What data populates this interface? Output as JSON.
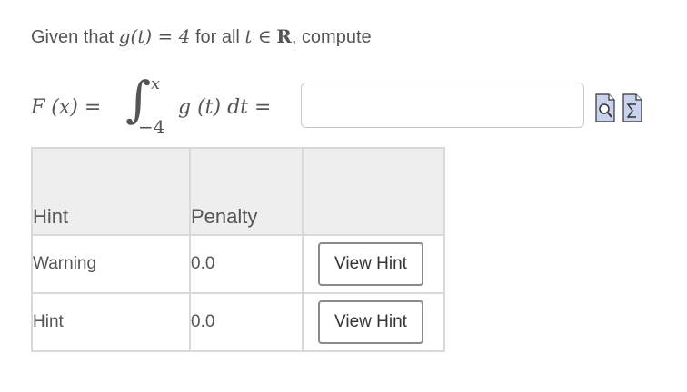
{
  "prompt": {
    "given": "Given that",
    "g_of_t": "g(t) = 4",
    "for_all": "for all",
    "t_in": "t ∈",
    "reals": "R",
    "compute": ", compute"
  },
  "equation": {
    "lhs": "F (x) =",
    "upper_limit": "x",
    "lower_limit": "−4",
    "integrand": "g (t)  dt   ="
  },
  "answer": {
    "value": "",
    "placeholder": ""
  },
  "icons": [
    "preview-icon",
    "equation-editor-icon"
  ],
  "hints_table": {
    "headers": [
      "Hint",
      "Penalty",
      ""
    ],
    "rows": [
      {
        "hint": "Warning",
        "penalty": "0.0",
        "button": "View Hint"
      },
      {
        "hint": "Hint",
        "penalty": "0.0",
        "button": "View Hint"
      }
    ]
  }
}
